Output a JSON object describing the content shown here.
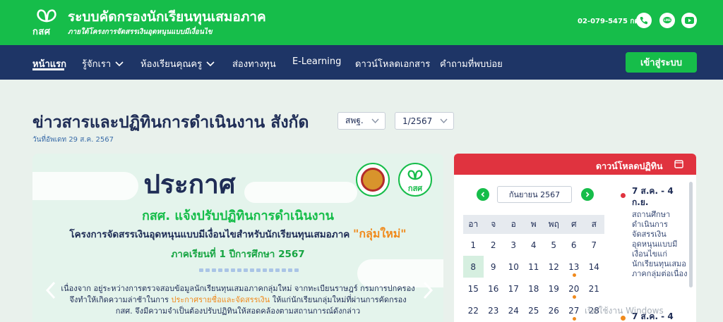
{
  "header": {
    "logo_text": "กสศ",
    "title": "ระบบคัดกรองนักเรียนทุนเสมอภาค",
    "subtitle": "ภายใต้โครงการจัดสรรเงินอุดหนุนแบบมีเงื่อนไข",
    "phone": "02-079-5475 กด 1",
    "icons": [
      "phone-icon",
      "line-icon",
      "youtube-icon"
    ]
  },
  "nav": {
    "items": [
      {
        "label": "หน้าแรก",
        "active": true
      },
      {
        "label": "รู้จักเรา",
        "dropdown": true
      },
      {
        "label": "ห้องเรียนคุณครู",
        "dropdown": true
      },
      {
        "label": "ส่องทางทุน"
      },
      {
        "label": "E-Learning"
      },
      {
        "label": "ดาวน์โหลดเอกสาร"
      },
      {
        "label": "คำถามที่พบบ่อย"
      }
    ],
    "login_label": "เข้าสู่ระบบ"
  },
  "main": {
    "title": "ข่าวสารและปฏิทินการดำเนินงาน   สังกัด",
    "filter_agency": "สพฐ.",
    "filter_term": "1/2567",
    "updated": "วันที่อัพเดท 29 ส.ค. 2567"
  },
  "banner": {
    "title": "ประกาศ",
    "brand_badge": "กสศ",
    "line1": "กสศ. แจ้งปรับปฏิทินการดำเนินงาน",
    "line2_pre": "โครงการจัดสรรเงินอุดหนุนแบบมีเงื่อนไขสำหรับนักเรียนทุนเสมอภาค ",
    "line2_hl": "\"กลุ่มใหม่\"",
    "line3": "ภาคเรียนที่ 1 ปีการศึกษา 2567",
    "body_1": "เนื่องจาก อยู่ระหว่างการตรวจสอบข้อมูลนักเรียนทุนเสมอภาคกลุ่มใหม่ จากทะเบียนราษฎร์ กรมการปกครอง",
    "body_2a": "จึงทำให้เกิดความล่าช้าในการ ",
    "body_2hl": "ประกาศรายชื่อและจัดสรรเงิน",
    "body_2b": " ให้แก่นักเรียนกลุ่มใหม่ที่ผ่านการคัดกรอง",
    "body_3": "กสศ. จึงมีความจำเป็นต้องปรับปฏิทินให้สอดคล้องตามสถานการณ์ดังกล่าว",
    "colors": {
      "accent_green": "#16bd4a",
      "highlight_orange": "#f08a1c",
      "navy": "#1f2d56"
    }
  },
  "calendar": {
    "panel_title": "ดาวน์โหลดปฏิทิน",
    "month": "กันยายน 2567",
    "weekdays": [
      "อา",
      "จ",
      "อ",
      "พ",
      "พฤ",
      "ศ",
      "ส"
    ],
    "weeks": [
      [
        "1",
        "2",
        "3",
        "4",
        "5",
        "6",
        "7"
      ],
      [
        "8",
        "9",
        "10",
        "11",
        "12",
        "13",
        "14"
      ],
      [
        "15",
        "16",
        "17",
        "18",
        "19",
        "20",
        "21"
      ],
      [
        "22",
        "23",
        "24",
        "25",
        "26",
        "27",
        "28"
      ]
    ],
    "today": "8",
    "marked_days": [
      "13",
      "20",
      "27"
    ],
    "events": [
      {
        "date": "7 ส.ค. - 4 ก.ย.",
        "desc": "สถานศึกษาดำเนินการจัดสรรเงินอุดหนุนแบบมีเงื่อนไขแก่นักเรียนทุนเสมอภาคกลุ่มต่อเนื่อง"
      },
      {
        "date": "7 ส.ค. - 4"
      }
    ]
  },
  "watermark": {
    "text": "เปิดใช้งาน Windows"
  }
}
